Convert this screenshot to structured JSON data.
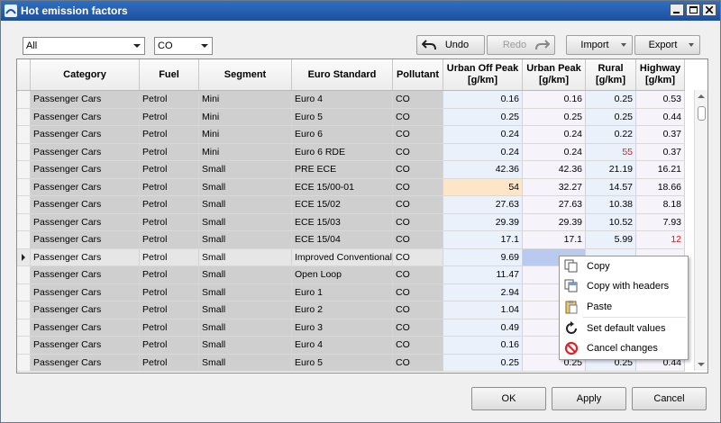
{
  "window": {
    "title": "Hot emission factors"
  },
  "toolbar": {
    "filter_value": "All",
    "pollutant_value": "CO",
    "undo_label": "Undo",
    "redo_label": "Redo",
    "import_label": "Import",
    "export_label": "Export"
  },
  "columns": [
    "Category",
    "Fuel",
    "Segment",
    "Euro Standard",
    "Pollutant",
    "Urban Off Peak [g/km]",
    "Urban Peak [g/km]",
    "Rural [g/km]",
    "Highway [g/km]"
  ],
  "rows": [
    [
      "Passenger Cars",
      "Petrol",
      "Mini",
      "Euro 4",
      "CO",
      "0.16",
      "0.16",
      "0.25",
      "0.53"
    ],
    [
      "Passenger Cars",
      "Petrol",
      "Mini",
      "Euro 5",
      "CO",
      "0.25",
      "0.25",
      "0.25",
      "0.44"
    ],
    [
      "Passenger Cars",
      "Petrol",
      "Mini",
      "Euro 6",
      "CO",
      "0.24",
      "0.24",
      "0.22",
      "0.37"
    ],
    [
      "Passenger Cars",
      "Petrol",
      "Mini",
      "Euro 6 RDE",
      "CO",
      "0.24",
      "0.24",
      "55",
      "0.37"
    ],
    [
      "Passenger Cars",
      "Petrol",
      "Small",
      "PRE ECE",
      "CO",
      "42.36",
      "42.36",
      "21.19",
      "16.21"
    ],
    [
      "Passenger Cars",
      "Petrol",
      "Small",
      "ECE 15/00-01",
      "CO",
      "54",
      "32.27",
      "14.57",
      "18.66"
    ],
    [
      "Passenger Cars",
      "Petrol",
      "Small",
      "ECE 15/02",
      "CO",
      "27.63",
      "27.63",
      "10.38",
      "8.18"
    ],
    [
      "Passenger Cars",
      "Petrol",
      "Small",
      "ECE 15/03",
      "CO",
      "29.39",
      "29.39",
      "10.52",
      "7.93"
    ],
    [
      "Passenger Cars",
      "Petrol",
      "Small",
      "ECE 15/04",
      "CO",
      "17.1",
      "17.1",
      "5.99",
      "12"
    ],
    [
      "Passenger Cars",
      "Petrol",
      "Small",
      "Improved Conventional",
      "CO",
      "9.69",
      "",
      "",
      ""
    ],
    [
      "Passenger Cars",
      "Petrol",
      "Small",
      "Open Loop",
      "CO",
      "11.47",
      "",
      "",
      ""
    ],
    [
      "Passenger Cars",
      "Petrol",
      "Small",
      "Euro 1",
      "CO",
      "2.94",
      "",
      "",
      ""
    ],
    [
      "Passenger Cars",
      "Petrol",
      "Small",
      "Euro 2",
      "CO",
      "1.04",
      "",
      "",
      ""
    ],
    [
      "Passenger Cars",
      "Petrol",
      "Small",
      "Euro 3",
      "CO",
      "0.49",
      "",
      "",
      ""
    ],
    [
      "Passenger Cars",
      "Petrol",
      "Small",
      "Euro 4",
      "CO",
      "0.16",
      "",
      "",
      ""
    ],
    [
      "Passenger Cars",
      "Petrol",
      "Small",
      "Euro 5",
      "CO",
      "0.25",
      "0.25",
      "0.25",
      "0.44"
    ]
  ],
  "red_cells": [
    [
      3,
      7
    ],
    [
      8,
      8
    ]
  ],
  "highlight_cells": [
    [
      5,
      5
    ]
  ],
  "selected_row": 9,
  "selected_cell": [
    9,
    6
  ],
  "context_menu": {
    "items": [
      "Copy",
      "Copy with headers",
      "Paste",
      "Set default values",
      "Cancel changes"
    ]
  },
  "footer": {
    "ok_label": "OK",
    "apply_label": "Apply",
    "cancel_label": "Cancel"
  },
  "colors": {
    "titlebar": "#1e4f9e",
    "red_value": "#e01b1b",
    "highlight": "#fde6c8",
    "selection": "#b9c9ef"
  }
}
